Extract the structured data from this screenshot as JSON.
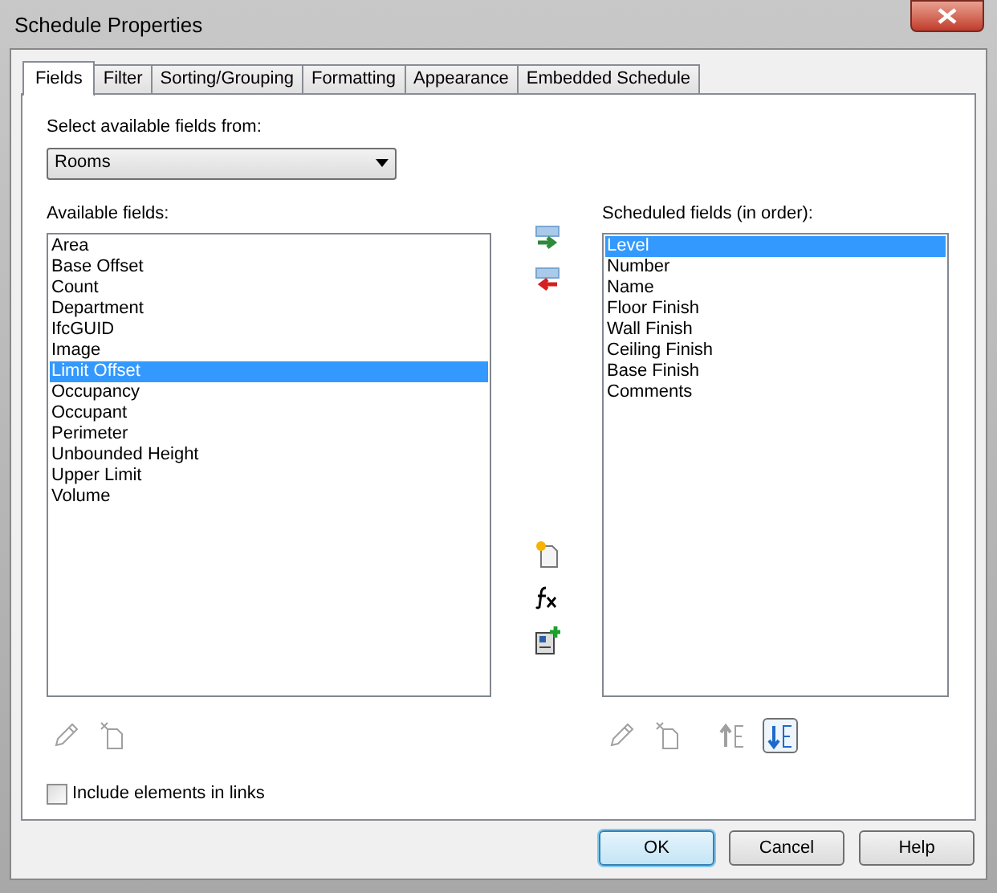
{
  "window": {
    "title": "Schedule Properties"
  },
  "tabs": [
    {
      "label": "Fields",
      "selected": true
    },
    {
      "label": "Filter",
      "selected": false
    },
    {
      "label": "Sorting/Grouping",
      "selected": false
    },
    {
      "label": "Formatting",
      "selected": false
    },
    {
      "label": "Appearance",
      "selected": false
    },
    {
      "label": "Embedded Schedule",
      "selected": false
    }
  ],
  "source": {
    "label": "Select available fields from:",
    "value": "Rooms"
  },
  "available": {
    "label": "Available fields:",
    "items": [
      {
        "text": "Area",
        "selected": false
      },
      {
        "text": "Base Offset",
        "selected": false
      },
      {
        "text": "Count",
        "selected": false
      },
      {
        "text": "Department",
        "selected": false
      },
      {
        "text": "IfcGUID",
        "selected": false
      },
      {
        "text": "Image",
        "selected": false
      },
      {
        "text": "Limit Offset",
        "selected": true
      },
      {
        "text": "Occupancy",
        "selected": false
      },
      {
        "text": "Occupant",
        "selected": false
      },
      {
        "text": "Perimeter",
        "selected": false
      },
      {
        "text": "Unbounded Height",
        "selected": false
      },
      {
        "text": "Upper Limit",
        "selected": false
      },
      {
        "text": "Volume",
        "selected": false
      }
    ]
  },
  "scheduled": {
    "label": "Scheduled fields (in order):",
    "items": [
      {
        "text": "Level",
        "selected": true
      },
      {
        "text": "Number",
        "selected": false
      },
      {
        "text": "Name",
        "selected": false
      },
      {
        "text": "Floor Finish",
        "selected": false
      },
      {
        "text": "Wall Finish",
        "selected": false
      },
      {
        "text": "Ceiling Finish",
        "selected": false
      },
      {
        "text": "Base Finish",
        "selected": false
      },
      {
        "text": "Comments",
        "selected": false
      }
    ]
  },
  "left_tools": [
    {
      "kind": "edit",
      "disabled": true
    },
    {
      "kind": "delete",
      "disabled": true
    }
  ],
  "right_tools": [
    {
      "kind": "edit",
      "disabled": true
    },
    {
      "kind": "delete",
      "disabled": true
    },
    {
      "kind": "move_up",
      "disabled": true
    },
    {
      "kind": "move_down",
      "disabled": false
    }
  ],
  "include_links": {
    "label": "Include elements in links",
    "checked": false
  },
  "buttons": [
    {
      "label": "OK",
      "default": true
    },
    {
      "label": "Cancel",
      "default": false
    },
    {
      "label": "Help",
      "default": false
    }
  ]
}
